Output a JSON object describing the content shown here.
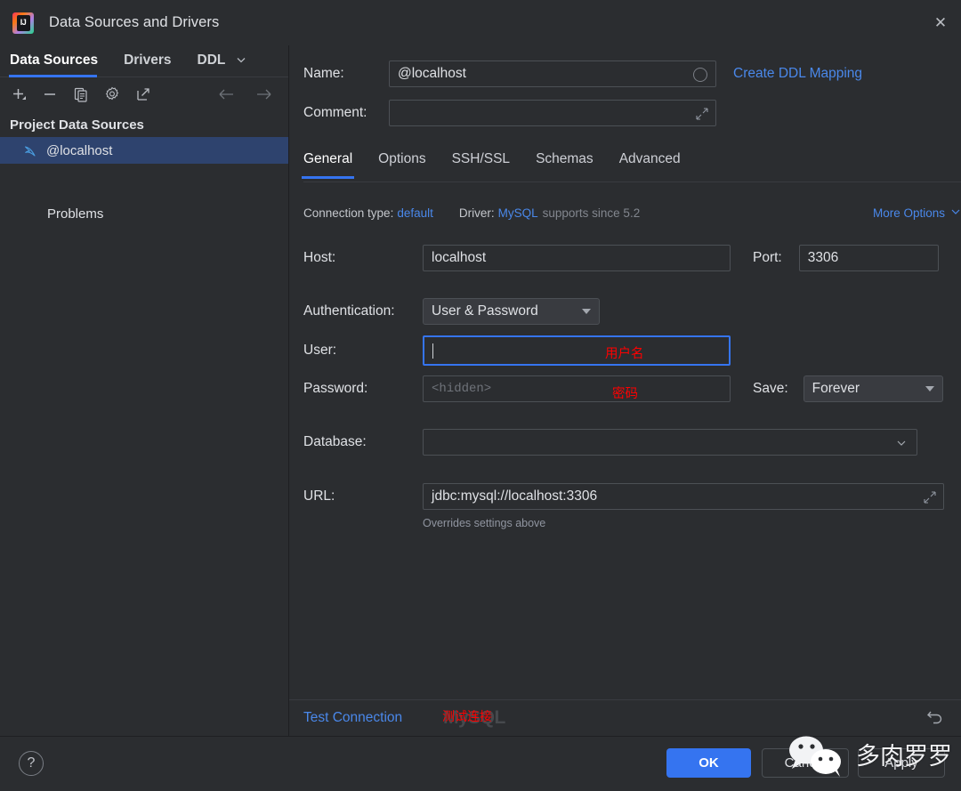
{
  "window": {
    "title": "Data Sources and Drivers",
    "logo_icon": "intellij-idea-logo",
    "close_icon": "close-icon"
  },
  "sidebar": {
    "tabs": [
      {
        "label": "Data Sources",
        "active": true
      },
      {
        "label": "Drivers",
        "active": false
      },
      {
        "label": "DDL",
        "active": false,
        "truncated": true
      }
    ],
    "chevron_icon": "chevron-down-icon",
    "toolbar": [
      {
        "name": "add-data-source-button",
        "icon": "plus-dropdown-icon"
      },
      {
        "name": "remove-data-source-button",
        "icon": "minus-icon"
      },
      {
        "name": "duplicate-data-source-button",
        "icon": "copy-icon"
      },
      {
        "name": "data-source-properties-button",
        "icon": "gear-icon"
      },
      {
        "name": "open-external-button",
        "icon": "external-link-icon"
      },
      {
        "name": "navigate-back-button",
        "icon": "arrow-left-icon"
      },
      {
        "name": "navigate-forward-button",
        "icon": "arrow-right-icon"
      }
    ],
    "section_title": "Project Data Sources",
    "data_sources": [
      {
        "label": "@localhost",
        "icon": "mysql-dolphin-icon",
        "selected": true
      }
    ],
    "problems_label": "Problems"
  },
  "header": {
    "name_label": "Name:",
    "name_value": "@localhost",
    "name_color_icon": "color-circle-icon",
    "create_ddl_mapping": "Create DDL Mapping",
    "comment_label": "Comment:",
    "comment_value": "",
    "comment_expand_icon": "expand-icon"
  },
  "tabs": [
    {
      "label": "General",
      "active": true
    },
    {
      "label": "Options",
      "active": false
    },
    {
      "label": "SSH/SSL",
      "active": false
    },
    {
      "label": "Schemas",
      "active": false
    },
    {
      "label": "Advanced",
      "active": false
    }
  ],
  "connection_info": {
    "connection_type_label": "Connection type:",
    "connection_type_value": "default",
    "driver_label": "Driver:",
    "driver_value": "MySQL",
    "driver_note": "supports since 5.2",
    "more_options": "More Options",
    "more_options_icon": "chevron-down-icon"
  },
  "form": {
    "host_label": "Host:",
    "host_value": "localhost",
    "port_label": "Port:",
    "port_value": "3306",
    "auth_label": "Authentication:",
    "auth_value": "User & Password",
    "user_label": "User:",
    "user_value": "",
    "password_label": "Password:",
    "password_placeholder": "<hidden>",
    "save_label": "Save:",
    "save_value": "Forever",
    "database_label": "Database:",
    "database_value": "",
    "url_label": "URL:",
    "url_value": "jdbc:mysql://localhost:3306",
    "url_note": "Overrides settings above",
    "url_expand_icon": "expand-icon",
    "database_dropdown_icon": "chevron-down-icon"
  },
  "annotations": {
    "user": "用户名",
    "password": "密码",
    "test_connection": "测试连接",
    "watermark_mysql": "MySQL"
  },
  "footer": {
    "test_connection": "Test Connection",
    "reset_icon": "undo-arrow-icon",
    "help_icon": "question-mark-icon",
    "ok": "OK",
    "cancel": "Cancel",
    "apply": "Apply"
  },
  "watermark": {
    "wechat_icon": "wechat-logo-icon",
    "text": "多肉罗罗"
  },
  "colors": {
    "accent_blue": "#3574f0",
    "link_blue": "#4a88ea",
    "annotation_red": "#ff0000",
    "background": "#2b2d30",
    "selection": "#2e436e"
  }
}
